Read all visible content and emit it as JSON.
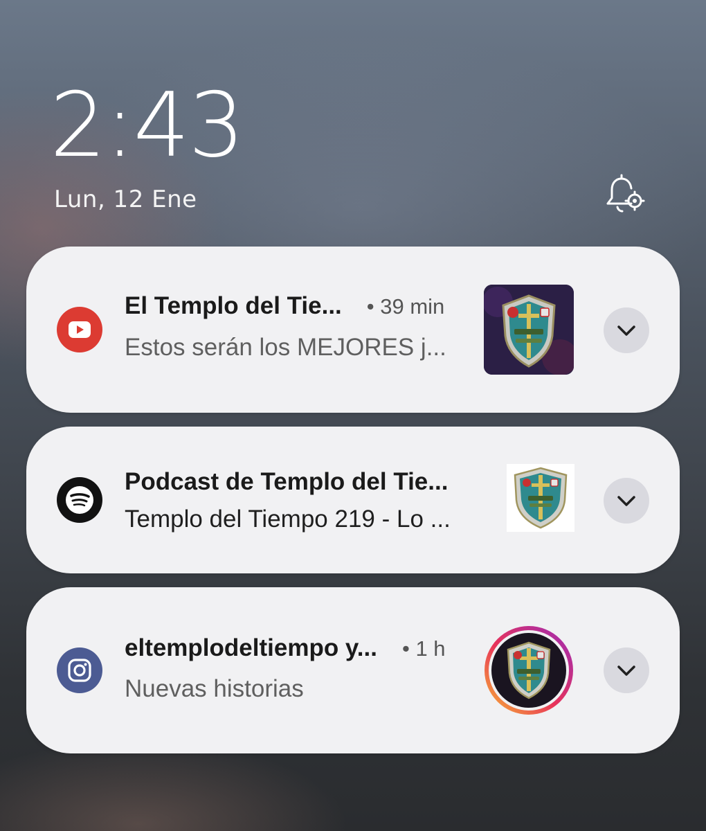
{
  "lockscreen": {
    "time": "2:43",
    "date": "Lun, 12 Ene",
    "settings_icon": "bell-settings-icon"
  },
  "notifications": [
    {
      "app": "youtube",
      "app_icon": "youtube-icon",
      "app_color": "#dc3b32",
      "title": "El Templo del Tie...",
      "time": "• 39 min",
      "text": "Estos serán los MEJORES j...",
      "thumbnail": "templo-shield-logo"
    },
    {
      "app": "spotify",
      "app_icon": "spotify-icon",
      "app_color": "#121212",
      "title": "Podcast de Templo del Tie...",
      "time": "",
      "text": "Templo del Tiempo 219 - Lo ...",
      "thumbnail": "templo-shield-logo"
    },
    {
      "app": "instagram",
      "app_icon": "instagram-icon",
      "app_color": "#4c5b93",
      "title": "eltemplodeltiempo y...",
      "time": "• 1 h",
      "text": "Nuevas historias",
      "thumbnail": "templo-shield-logo-story-ring"
    }
  ],
  "expand_icon": "chevron-down-icon"
}
